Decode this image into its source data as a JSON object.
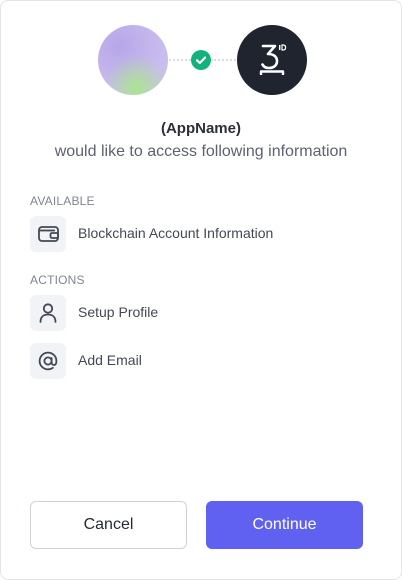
{
  "header": {
    "app_avatar_icon": "app-avatar-gradient",
    "connected_icon": "check-icon",
    "brand_icon": "3id-logo-icon",
    "colors": {
      "check": "#12b27a",
      "brand_bg": "#1f242e"
    }
  },
  "app_name": "(AppName)",
  "subtitle": "would like to access following information",
  "sections": {
    "available_label": "AVAILABLE",
    "available_items": [
      {
        "label": "Blockchain Account Information",
        "icon": "wallet-icon"
      }
    ],
    "actions_label": "ACTIONS",
    "action_items": [
      {
        "label": "Setup Profile",
        "icon": "user-icon"
      },
      {
        "label": "Add Email",
        "icon": "at-sign-icon"
      }
    ]
  },
  "buttons": {
    "cancel_label": "Cancel",
    "continue_label": "Continue",
    "accent_color": "#6161f1"
  }
}
